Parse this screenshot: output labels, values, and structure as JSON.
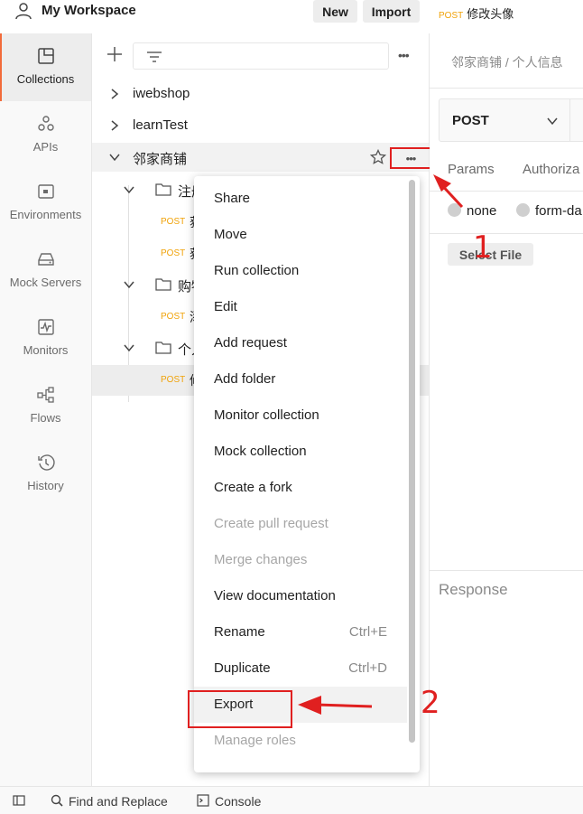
{
  "header": {
    "workspace_title": "My Workspace",
    "new_label": "New",
    "import_label": "Import",
    "workspace_icon": "user-icon"
  },
  "sidebar": {
    "items": [
      {
        "label": "Collections",
        "icon": "collections-icon",
        "active": true
      },
      {
        "label": "APIs",
        "icon": "apis-icon",
        "active": false
      },
      {
        "label": "Environments",
        "icon": "environments-icon",
        "active": false
      },
      {
        "label": "Mock Servers",
        "icon": "mock-servers-icon",
        "active": false
      },
      {
        "label": "Monitors",
        "icon": "monitors-icon",
        "active": false
      },
      {
        "label": "Flows",
        "icon": "flows-icon",
        "active": false
      },
      {
        "label": "History",
        "icon": "history-icon",
        "active": false
      }
    ]
  },
  "tree": {
    "more_label": "•••",
    "collections": [
      {
        "name": "iwebshop",
        "expanded": false
      },
      {
        "name": "learnTest",
        "expanded": false
      },
      {
        "name": "邻家商铺",
        "expanded": true
      }
    ],
    "folders": [
      {
        "name": "注册"
      },
      {
        "name": "购物"
      },
      {
        "name": "个人"
      }
    ],
    "requests": [
      {
        "method": "POST",
        "name": "获"
      },
      {
        "method": "POST",
        "name": "获"
      },
      {
        "method": "POST",
        "name": "添"
      },
      {
        "method": "POST",
        "name": "修"
      }
    ],
    "collection_more_label": "•••"
  },
  "request_panel": {
    "tab_method": "POST",
    "tab_title": "修改头像",
    "breadcrumb": "邻家商铺  /  个人信息",
    "method": "POST",
    "tabs": [
      "Params",
      "Authoriza"
    ],
    "body_options": [
      "none",
      "form-da"
    ],
    "select_file_label": "Select File",
    "response_label": "Response"
  },
  "context_menu": {
    "items": [
      {
        "label": "Share",
        "shortcut": "",
        "disabled": false
      },
      {
        "label": "Move",
        "shortcut": "",
        "disabled": false
      },
      {
        "label": "Run collection",
        "shortcut": "",
        "disabled": false
      },
      {
        "label": "Edit",
        "shortcut": "",
        "disabled": false
      },
      {
        "label": "Add request",
        "shortcut": "",
        "disabled": false
      },
      {
        "label": "Add folder",
        "shortcut": "",
        "disabled": false
      },
      {
        "label": "Monitor collection",
        "shortcut": "",
        "disabled": false
      },
      {
        "label": "Mock collection",
        "shortcut": "",
        "disabled": false
      },
      {
        "label": "Create a fork",
        "shortcut": "",
        "disabled": false
      },
      {
        "label": "Create pull request",
        "shortcut": "",
        "disabled": true
      },
      {
        "label": "Merge changes",
        "shortcut": "",
        "disabled": true
      },
      {
        "label": "View documentation",
        "shortcut": "",
        "disabled": false
      },
      {
        "label": "Rename",
        "shortcut": "Ctrl+E",
        "disabled": false
      },
      {
        "label": "Duplicate",
        "shortcut": "Ctrl+D",
        "disabled": false
      },
      {
        "label": "Export",
        "shortcut": "",
        "disabled": false,
        "highlighted": true
      },
      {
        "label": "Manage roles",
        "shortcut": "",
        "disabled": true
      }
    ]
  },
  "annotations": {
    "step1": "1",
    "step2": "2",
    "color": "#e02020"
  },
  "statusbar": {
    "find_replace_label": "Find and Replace",
    "console_label": "Console"
  },
  "colors": {
    "accent": "#f26b3a",
    "post": "#f0a30a",
    "annotation": "#e02020"
  }
}
